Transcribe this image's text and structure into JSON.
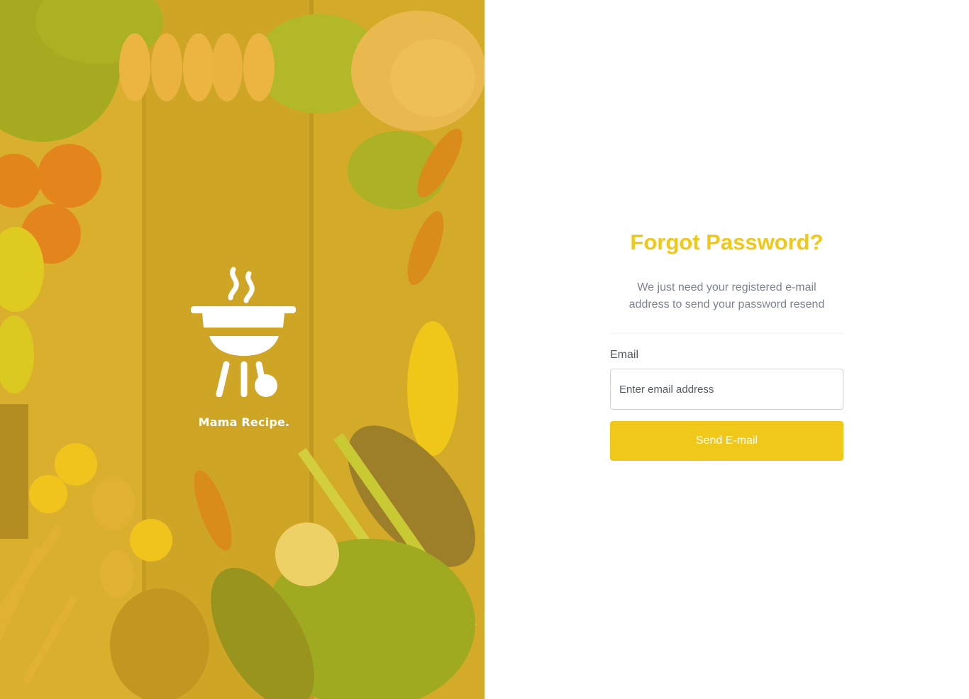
{
  "brand": {
    "name": "Mama Recipe."
  },
  "form": {
    "title": "Forgot Password?",
    "subtitle": "We just need your registered e-mail address to send your password resend",
    "email_label": "Email",
    "email_placeholder": "Enter email address",
    "email_value": "",
    "submit_label": "Send E-mail"
  },
  "colors": {
    "accent": "#EFC81A",
    "subtitle": "#7B8494",
    "overlay": "#EEC41A"
  },
  "icons": {
    "logo": "barbecue-grill-icon"
  }
}
